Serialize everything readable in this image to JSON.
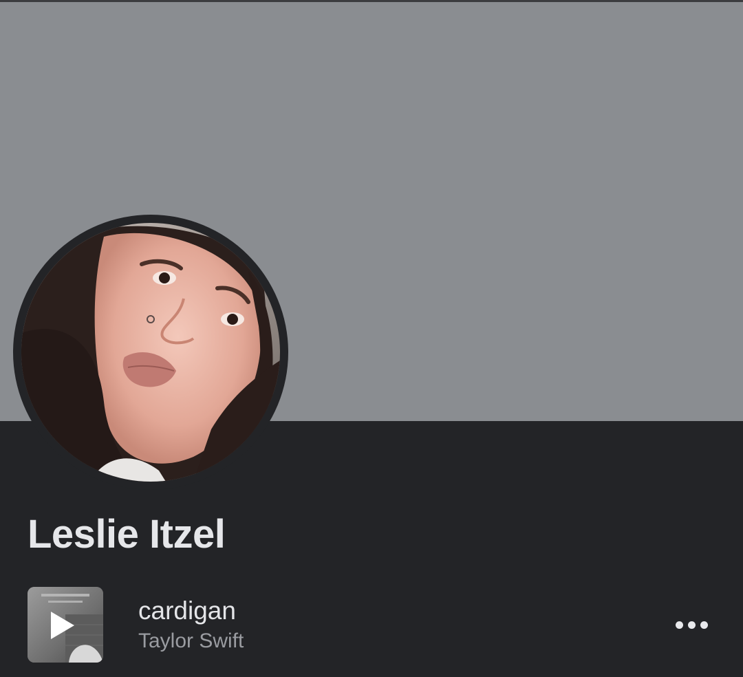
{
  "profile": {
    "name": "Leslie Itzel",
    "avatar_icon": "profile-photo",
    "cover_color": "#8a8d91"
  },
  "now_playing": {
    "title": "cardigan",
    "artist": "Taylor Swift",
    "album_art_icon": "album-cover",
    "play_icon": "play-icon",
    "more_icon": "more-horizontal-icon"
  },
  "colors": {
    "background": "#232427",
    "title_text": "#e6e7ea",
    "secondary_text": "#9a9ca1"
  }
}
